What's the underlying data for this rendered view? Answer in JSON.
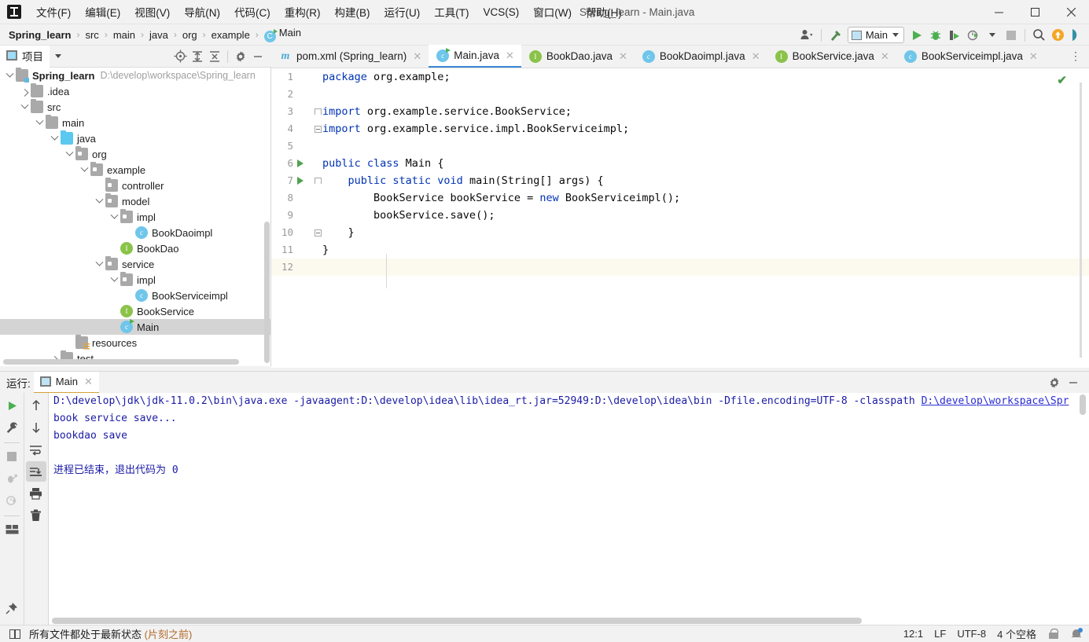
{
  "window": {
    "title": "Spring_learn - Main.java",
    "minimize_label": "–",
    "maximize_label": "☐",
    "close_label": "✕"
  },
  "menu": {
    "items": [
      {
        "label": "文件(F)"
      },
      {
        "label": "编辑(E)"
      },
      {
        "label": "视图(V)"
      },
      {
        "label": "导航(N)"
      },
      {
        "label": "代码(C)"
      },
      {
        "label": "重构(R)"
      },
      {
        "label": "构建(B)"
      },
      {
        "label": "运行(U)"
      },
      {
        "label": "工具(T)"
      },
      {
        "label": "VCS(S)"
      },
      {
        "label": "窗口(W)"
      },
      {
        "label": "帮助(H)"
      }
    ]
  },
  "breadcrumb": {
    "items": [
      {
        "label": "Spring_learn",
        "bold": true
      },
      {
        "label": "src",
        "bold": false
      },
      {
        "label": "main",
        "bold": false
      },
      {
        "label": "java",
        "bold": false
      },
      {
        "label": "org",
        "bold": false
      },
      {
        "label": "example",
        "bold": false
      },
      {
        "label": "Main",
        "bold": false,
        "icon": "java-class-run-icon"
      }
    ],
    "separator": "›"
  },
  "toolbar": {
    "run_config_name": "Main",
    "icons": [
      "user-account-icon",
      "build-hammer-icon",
      "run-icon",
      "debug-icon",
      "run-with-coverage-icon",
      "profile-icon",
      "stop-icon",
      "search-everywhere-icon",
      "update-project-icon",
      "ide-assistant-icon"
    ]
  },
  "project_panel": {
    "tab_label": "项目",
    "tools": [
      "locate-icon",
      "expand-all-icon",
      "collapse-all-icon",
      "settings-gear-icon",
      "hide-icon"
    ],
    "tree": [
      {
        "label": "Spring_learn",
        "path": "D:\\develop\\workspace\\Spring_learn",
        "depth": 0,
        "twist": "down",
        "icon": "module-folder-icon",
        "bold": true,
        "selected": false
      },
      {
        "label": ".idea",
        "path": "",
        "depth": 1,
        "twist": "right",
        "icon": "folder-icon",
        "bold": false,
        "selected": false
      },
      {
        "label": "src",
        "path": "",
        "depth": 1,
        "twist": "down",
        "icon": "folder-icon",
        "bold": false,
        "selected": false
      },
      {
        "label": "main",
        "path": "",
        "depth": 2,
        "twist": "down",
        "icon": "folder-icon",
        "bold": false,
        "selected": false
      },
      {
        "label": "java",
        "path": "",
        "depth": 3,
        "twist": "down",
        "icon": "source-folder-icon",
        "bold": false,
        "selected": false
      },
      {
        "label": "org",
        "path": "",
        "depth": 4,
        "twist": "down",
        "icon": "package-icon",
        "bold": false,
        "selected": false
      },
      {
        "label": "example",
        "path": "",
        "depth": 5,
        "twist": "down",
        "icon": "package-icon",
        "bold": false,
        "selected": false
      },
      {
        "label": "controller",
        "path": "",
        "depth": 6,
        "twist": "none",
        "icon": "package-icon",
        "bold": false,
        "selected": false
      },
      {
        "label": "model",
        "path": "",
        "depth": 6,
        "twist": "down",
        "icon": "package-icon",
        "bold": false,
        "selected": false
      },
      {
        "label": "impl",
        "path": "",
        "depth": 7,
        "twist": "down",
        "icon": "package-icon",
        "bold": false,
        "selected": false
      },
      {
        "label": "BookDaoimpl",
        "path": "",
        "depth": 8,
        "twist": "none",
        "icon": "java-class-icon",
        "bold": false,
        "selected": false
      },
      {
        "label": "BookDao",
        "path": "",
        "depth": 7,
        "twist": "none",
        "icon": "java-interface-icon",
        "bold": false,
        "selected": false
      },
      {
        "label": "service",
        "path": "",
        "depth": 6,
        "twist": "down",
        "icon": "package-icon",
        "bold": false,
        "selected": false
      },
      {
        "label": "impl",
        "path": "",
        "depth": 7,
        "twist": "down",
        "icon": "package-icon",
        "bold": false,
        "selected": false
      },
      {
        "label": "BookServiceimpl",
        "path": "",
        "depth": 8,
        "twist": "none",
        "icon": "java-class-icon",
        "bold": false,
        "selected": false
      },
      {
        "label": "BookService",
        "path": "",
        "depth": 7,
        "twist": "none",
        "icon": "java-interface-icon",
        "bold": false,
        "selected": false
      },
      {
        "label": "Main",
        "path": "",
        "depth": 7,
        "twist": "none",
        "icon": "java-class-run-icon",
        "bold": false,
        "selected": true
      },
      {
        "label": "resources",
        "path": "",
        "depth": 4,
        "twist": "none",
        "icon": "resources-folder-icon",
        "bold": false,
        "selected": false
      },
      {
        "label": "test",
        "path": "",
        "depth": 3,
        "twist": "right",
        "icon": "folder-icon",
        "bold": false,
        "selected": false
      }
    ]
  },
  "editor": {
    "tabs": [
      {
        "label": "pom.xml (Spring_learn)",
        "icon": "maven-icon",
        "active": false,
        "close": "✕"
      },
      {
        "label": "Main.java",
        "icon": "java-class-run-icon",
        "active": true,
        "close": "✕"
      },
      {
        "label": "BookDao.java",
        "icon": "java-interface-icon",
        "active": false,
        "close": "✕"
      },
      {
        "label": "BookDaoimpl.java",
        "icon": "java-class-icon",
        "active": false,
        "close": "✕"
      },
      {
        "label": "BookService.java",
        "icon": "java-interface-icon",
        "active": false,
        "close": "✕"
      },
      {
        "label": "BookServiceimpl.java",
        "icon": "java-class-icon",
        "active": false,
        "close": "✕"
      }
    ],
    "tabs_overflow": "⋮",
    "inspection_status": "✔",
    "lines": [
      {
        "no": "1",
        "gutter_run": false,
        "fold": "",
        "tokens": [
          {
            "t": "package",
            "c": "kw"
          },
          {
            "t": " org.example;",
            "c": "pl"
          }
        ]
      },
      {
        "no": "2",
        "gutter_run": false,
        "fold": "",
        "tokens": []
      },
      {
        "no": "3",
        "gutter_run": false,
        "fold": "open",
        "tokens": [
          {
            "t": "import",
            "c": "kw"
          },
          {
            "t": " org.example.service.BookService;",
            "c": "pl"
          }
        ]
      },
      {
        "no": "4",
        "gutter_run": false,
        "fold": "minus",
        "tokens": [
          {
            "t": "import",
            "c": "kw"
          },
          {
            "t": " org.example.service.impl.BookServiceimpl;",
            "c": "pl"
          }
        ]
      },
      {
        "no": "5",
        "gutter_run": false,
        "fold": "",
        "tokens": []
      },
      {
        "no": "6",
        "gutter_run": true,
        "fold": "",
        "tokens": [
          {
            "t": "public class",
            "c": "kw"
          },
          {
            "t": " Main {",
            "c": "pl"
          }
        ]
      },
      {
        "no": "7",
        "gutter_run": true,
        "fold": "open",
        "tokens": [
          {
            "t": "    public static void",
            "c": "kw"
          },
          {
            "t": " main(String[] args) {",
            "c": "pl"
          }
        ]
      },
      {
        "no": "8",
        "gutter_run": false,
        "fold": "",
        "tokens": [
          {
            "t": "        BookService bookService = ",
            "c": "pl"
          },
          {
            "t": "new",
            "c": "kw"
          },
          {
            "t": " BookServiceimpl();",
            "c": "pl"
          }
        ]
      },
      {
        "no": "9",
        "gutter_run": false,
        "fold": "",
        "tokens": [
          {
            "t": "        bookService.save();",
            "c": "pl"
          }
        ]
      },
      {
        "no": "10",
        "gutter_run": false,
        "fold": "minus",
        "tokens": [
          {
            "t": "    }",
            "c": "pl"
          }
        ]
      },
      {
        "no": "11",
        "gutter_run": false,
        "fold": "",
        "tokens": [
          {
            "t": "}",
            "c": "pl"
          }
        ]
      },
      {
        "no": "12",
        "gutter_run": false,
        "fold": "",
        "tokens": [],
        "current": true
      }
    ]
  },
  "run_panel": {
    "title": "运行:",
    "tab_label": "Main",
    "tab_close": "✕",
    "right_icons": [
      "settings-gear-icon",
      "hide-icon"
    ],
    "left_tools": [
      "rerun-icon",
      "wrench-icon",
      "stop-icon",
      "resume-program-icon",
      "pause-icon",
      "layout-icon",
      "pin-icon"
    ],
    "right_tools": [
      "scroll-up-icon",
      "scroll-down-icon",
      "soft-wrap-icon",
      "scroll-to-end-icon",
      "print-icon",
      "clear-all-icon"
    ],
    "console": {
      "command_prefix": "D:\\develop\\jdk\\jdk-11.0.2\\bin\\java.exe -javaagent:D:\\develop\\idea\\lib\\idea_rt.jar=52949:D:\\develop\\idea\\bin -Dfile.encoding=UTF-8 -classpath ",
      "command_link": "D:\\develop\\workspace\\Spr",
      "lines": [
        "book service save...",
        "bookdao save"
      ],
      "exit_text": "进程已结束，退出代码为 ",
      "exit_code": "0"
    }
  },
  "status_bar": {
    "message": "所有文件都处于最新状态 ",
    "message_time": "(片刻之前)",
    "position": "12:1",
    "line_sep": "LF",
    "encoding": "UTF-8",
    "indent": "4 个空格",
    "icons": [
      "lock-icon",
      "notification-bell-icon"
    ]
  },
  "colors": {
    "accent_blue": "#3b87d6",
    "keyword_blue": "#0033b3",
    "console_blue": "#1a1aa6",
    "run_green": "#52a152",
    "class_icon": "#6fc6ea",
    "interface_icon": "#8bc34a",
    "selection_gray": "#d4d4d4",
    "current_line": "#fcfaef"
  }
}
